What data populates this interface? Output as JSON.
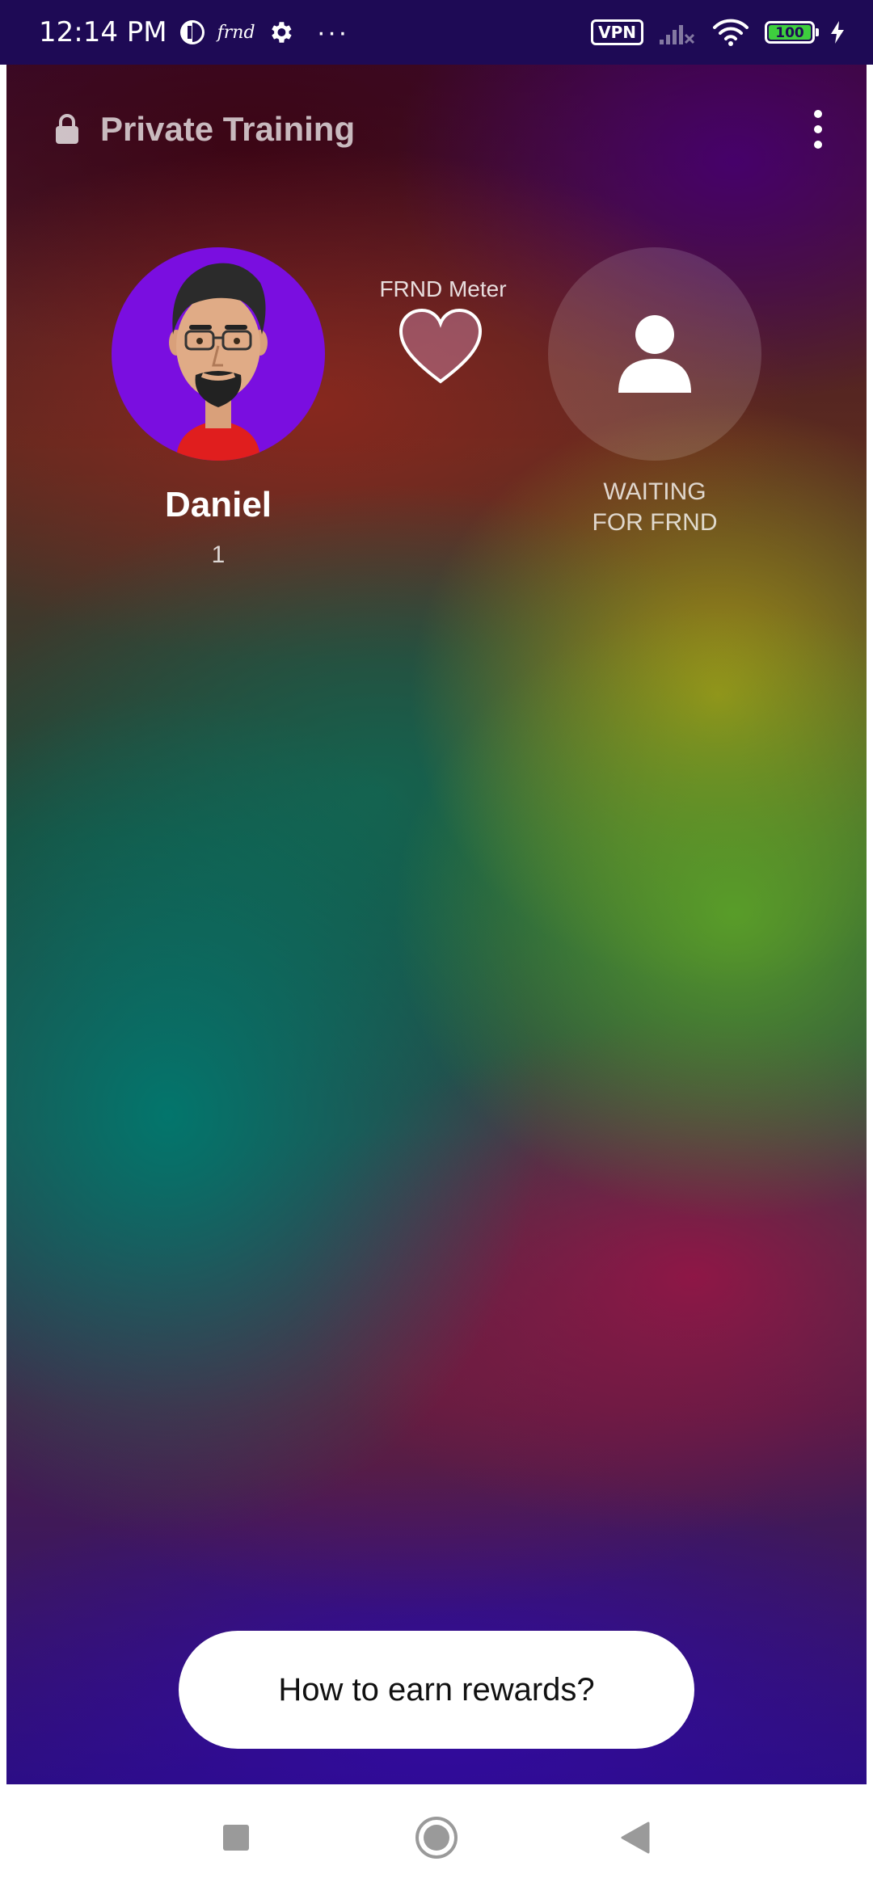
{
  "status_bar": {
    "time": "12:14 PM",
    "app_label": "frnd",
    "more": "···",
    "vpn": "VPN",
    "battery": "100"
  },
  "header": {
    "title": "Private Training",
    "lock_icon": "lock-icon",
    "menu_icon": "more-vert-icon"
  },
  "user": {
    "name": "Daniel",
    "count": "1"
  },
  "meter": {
    "label": "FRND Meter"
  },
  "partner": {
    "status_line1": "WAITING",
    "status_line2": "FOR FRND"
  },
  "rewards_button": {
    "label": "How to earn rewards?"
  },
  "colors": {
    "status_bar_bg": "#1e0a55",
    "avatar_bg": "#7a0ee0",
    "button_bg": "#ffffff"
  },
  "nav": {
    "recents_icon": "square-icon",
    "home_icon": "circle-icon",
    "back_icon": "triangle-back-icon"
  }
}
